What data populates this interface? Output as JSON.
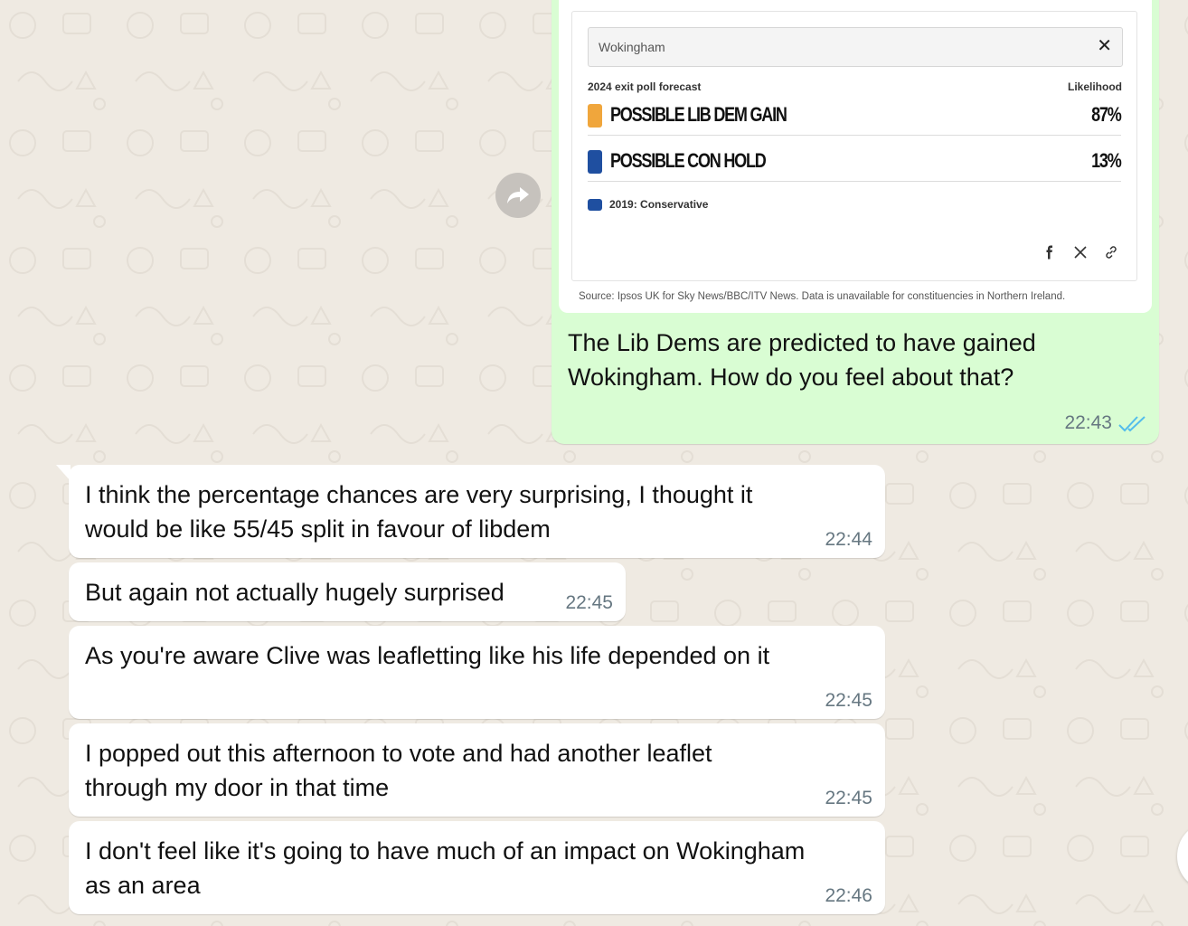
{
  "outgoing": {
    "card": {
      "search_value": "Wokingham",
      "forecast_label": "2024 exit poll forecast",
      "likelihood_label": "Likelihood",
      "rows": [
        {
          "name": "POSSIBLE LIB DEM GAIN",
          "percent": "87%",
          "color": "#f0a63c"
        },
        {
          "name": "POSSIBLE CON HOLD",
          "percent": "13%",
          "color": "#1f4fa0"
        }
      ],
      "previous": {
        "text": "2019: Conservative",
        "color": "#1f4fa0"
      },
      "source": "Source: Ipsos UK for Sky News/BBC/ITV News. Data is unavailable for constituencies in Northern Ireland.",
      "share_icons": [
        "facebook-icon",
        "x-icon",
        "link-icon"
      ]
    },
    "text": "The Lib Dems are predicted to have gained Wokingham. How do you feel about that?",
    "time": "22:43",
    "status": "read",
    "tick_color": "#53bdeb",
    "bubble_color": "#d9fdd3"
  },
  "incoming": [
    {
      "lines": [
        "I think the percentage chances are very surprising, I thought it",
        "would be like 55/45 split in favour of libdem"
      ],
      "time": "22:44"
    },
    {
      "lines": [
        "But again not actually hugely surprised"
      ],
      "time": "22:45"
    },
    {
      "lines": [
        "As you're aware Clive was leafletting like his life depended on it"
      ],
      "time": "22:45"
    },
    {
      "lines": [
        "I popped out this afternoon to vote and had another leaflet",
        "through my door in that time"
      ],
      "time": "22:45"
    },
    {
      "lines": [
        "I don't feel like it's going to have much of an impact on Wokingham",
        "as an area"
      ],
      "time": "22:46"
    }
  ],
  "colors": {
    "chat_background": "#efeae2",
    "time_color": "#667781"
  }
}
